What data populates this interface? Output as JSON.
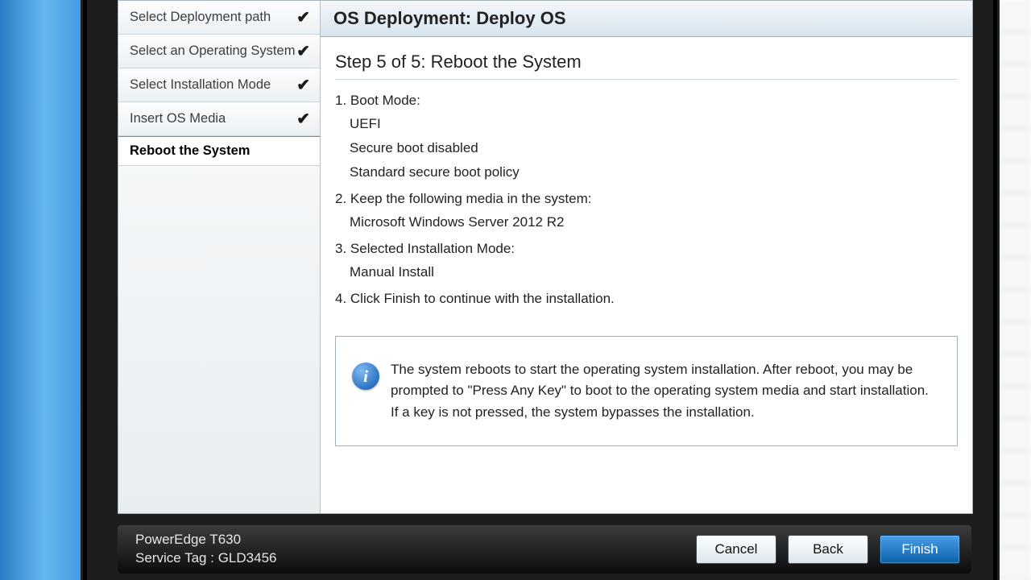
{
  "sidebar": {
    "steps": [
      {
        "label": "Select Deployment path",
        "done": true
      },
      {
        "label": "Select an Operating System",
        "done": true
      },
      {
        "label": "Select Installation Mode",
        "done": true
      },
      {
        "label": "Insert OS Media",
        "done": true
      },
      {
        "label": "Reboot the System",
        "done": false,
        "active": true
      }
    ]
  },
  "header": {
    "title": "OS Deployment: Deploy OS"
  },
  "content": {
    "step_heading": "Step 5 of 5: Reboot the System",
    "items": {
      "boot_mode_label": "1. Boot Mode:",
      "boot_mode_values": [
        "UEFI",
        "Secure boot disabled",
        "Standard secure boot policy"
      ],
      "media_label": "2. Keep the following media in the system:",
      "media_value": "Microsoft Windows Server 2012 R2",
      "install_mode_label": "3. Selected Installation Mode:",
      "install_mode_value": "Manual Install",
      "finish_label": "4. Click Finish to continue with the installation."
    },
    "info": "The system reboots to start the operating system installation. After reboot, you may be prompted to \"Press Any Key\" to boot to the operating system media and start installation. If a key is not pressed, the system bypasses the installation."
  },
  "footer": {
    "model": "PowerEdge T630",
    "service_tag_label": "Service Tag :",
    "service_tag": "GLD3456",
    "buttons": {
      "cancel": "Cancel",
      "back": "Back",
      "finish": "Finish"
    }
  }
}
